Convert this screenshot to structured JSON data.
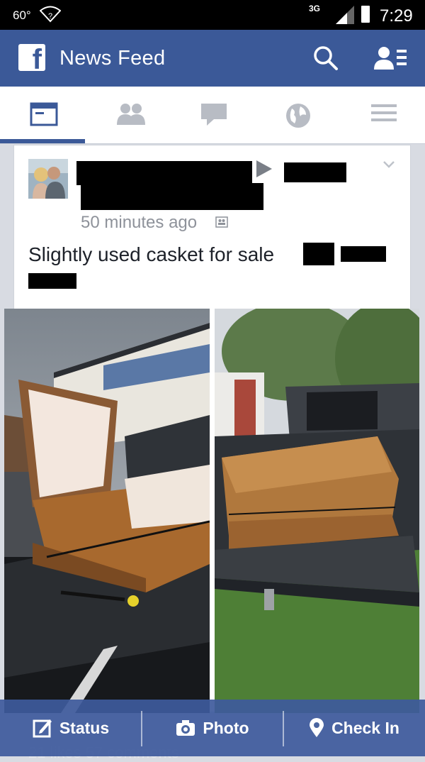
{
  "status_bar": {
    "temperature": "60°",
    "network": "3G",
    "time": "7:29"
  },
  "header": {
    "title": "News Feed",
    "logo_letter": "f"
  },
  "tabs": [
    {
      "icon": "news-feed-icon",
      "active": true
    },
    {
      "icon": "friend-requests-icon",
      "active": false
    },
    {
      "icon": "messages-icon",
      "active": false
    },
    {
      "icon": "notifications-globe-icon",
      "active": false
    },
    {
      "icon": "more-menu-icon",
      "active": false
    }
  ],
  "post": {
    "time": "50 minutes ago",
    "text": "Slightly used casket for sale",
    "audience_icon": "friends-audience-icon"
  },
  "footer_faint": "21 likes   57 comments",
  "bottom_bar": {
    "status": "Status",
    "photo": "Photo",
    "check_in": "Check In"
  },
  "colors": {
    "brand": "#3b5998",
    "status_bar": "#000000",
    "text": "#1d2129",
    "muted": "#8e929a"
  }
}
